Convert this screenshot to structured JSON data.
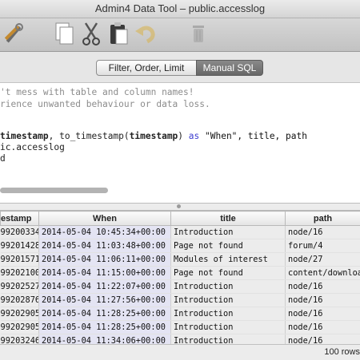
{
  "window": {
    "title": "Admin4 Data Tool – public.accesslog"
  },
  "toolbar": {
    "buttons": [
      {
        "name": "tools-icon"
      },
      {
        "name": "copy-icon"
      },
      {
        "name": "cut-icon"
      },
      {
        "name": "paste-icon"
      },
      {
        "name": "undo-icon"
      },
      {
        "name": "trash-icon"
      }
    ]
  },
  "tabs": [
    {
      "label": "Filter, Order, Limit"
    },
    {
      "label": "Manual SQL"
    }
  ],
  "editor": {
    "comment1": "'t mess with table and column names!",
    "comment2": "rience unwanted behaviour or data loss.",
    "sql_ts1": "timestamp",
    "sql_mid1": ", to_timestamp(",
    "sql_ts2": "timestamp",
    "sql_mid2": ") ",
    "sql_as": "as",
    "sql_tail": " \"When\", title, path",
    "sql_line2": "ic.accesslog",
    "sql_line3": "d"
  },
  "table": {
    "columns": [
      "estamp",
      "When",
      "title",
      "path"
    ],
    "rows": [
      [
        "99200334",
        "2014-05-04 10:45:34+00:00",
        "Introduction",
        "node/16"
      ],
      [
        "99201428",
        "2014-05-04 11:03:48+00:00",
        "Page not found",
        "forum/4"
      ],
      [
        "99201571",
        "2014-05-04 11:06:11+00:00",
        "Modules of interest",
        "node/27"
      ],
      [
        "99202100",
        "2014-05-04 11:15:00+00:00",
        "Page not found",
        "content/downloa"
      ],
      [
        "99202527",
        "2014-05-04 11:22:07+00:00",
        "Introduction",
        "node/16"
      ],
      [
        "99202876",
        "2014-05-04 11:27:56+00:00",
        "Introduction",
        "node/16"
      ],
      [
        "99202905",
        "2014-05-04 11:28:25+00:00",
        "Introduction",
        "node/16"
      ],
      [
        "99202905",
        "2014-05-04 11:28:25+00:00",
        "Introduction",
        "node/16"
      ],
      [
        "99203246",
        "2014-05-04 11:34:06+00:00",
        "Introduction",
        "node/16"
      ]
    ]
  },
  "status": {
    "rows_text": "100 rows"
  }
}
